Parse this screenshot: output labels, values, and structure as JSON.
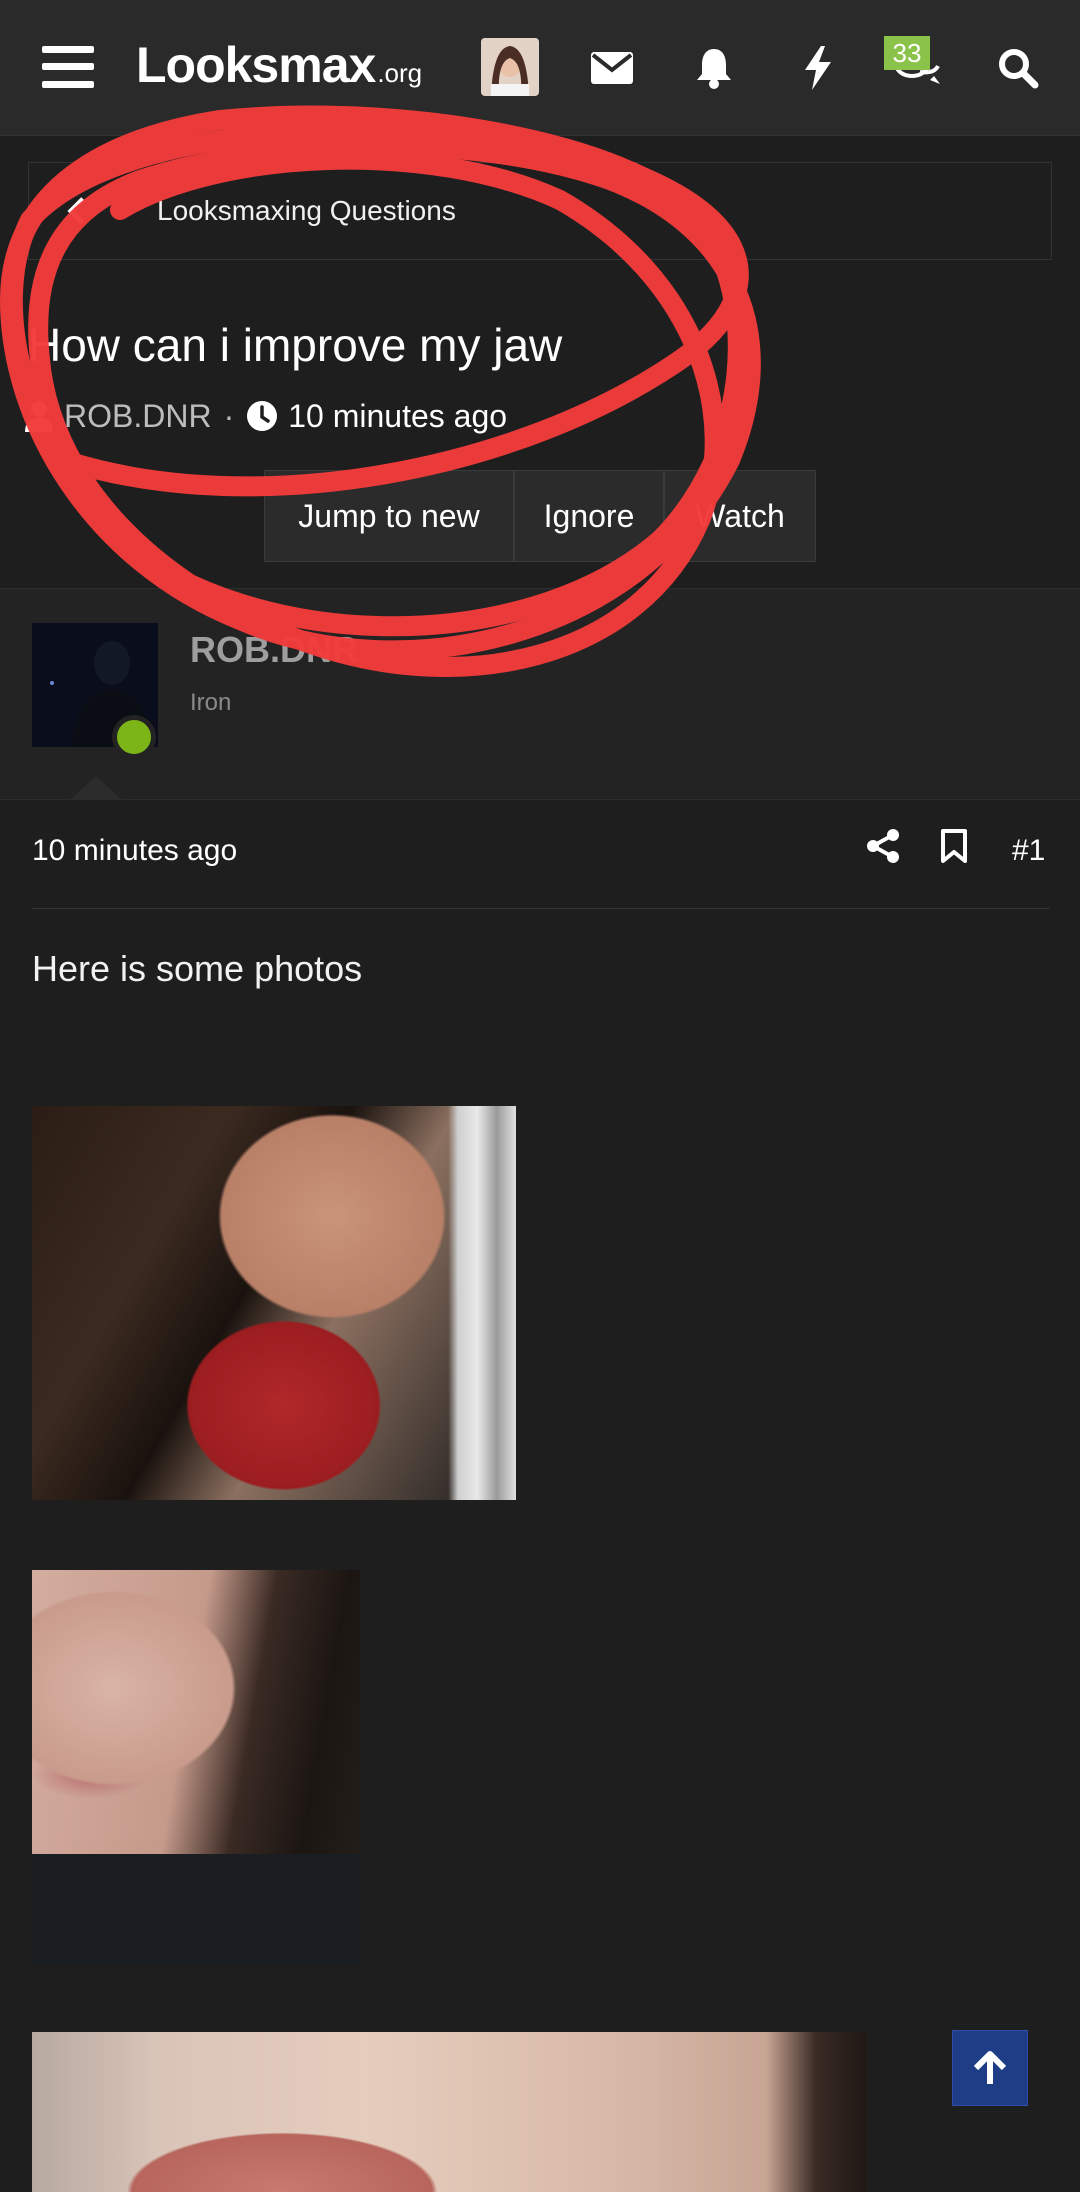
{
  "header": {
    "logo_main": "Looksmax",
    "logo_tld": ".org",
    "conversations_badge": "33"
  },
  "breadcrumb": {
    "label": "Looksmaxing Questions"
  },
  "thread": {
    "title": "How can i improve my jaw",
    "author": "ROB.DNR",
    "separator": "·",
    "time": "10 minutes ago"
  },
  "actions": {
    "jump_to_new": "Jump to new",
    "ignore": "Ignore",
    "watch": "Watch"
  },
  "post": {
    "username": "ROB.DNR",
    "user_title": "Iron",
    "time": "10 minutes ago",
    "number": "#1",
    "body": "Here is some photos"
  },
  "colors": {
    "background": "#1e1e1e",
    "header": "#2a2a2a",
    "badge": "#8bc34a",
    "online": "#7cb518",
    "scroll_top": "#1f3c87",
    "annotation": "#f23b3b"
  },
  "icons": {
    "menu": "hamburger-icon",
    "profile": "profile-avatar",
    "inbox": "envelope-icon",
    "alerts": "bell-icon",
    "whats_new": "bolt-icon",
    "conversations": "chat-bubbles-icon",
    "search": "search-icon",
    "share": "share-icon",
    "bookmark": "bookmark-icon",
    "scroll_top": "arrow-up-icon"
  }
}
